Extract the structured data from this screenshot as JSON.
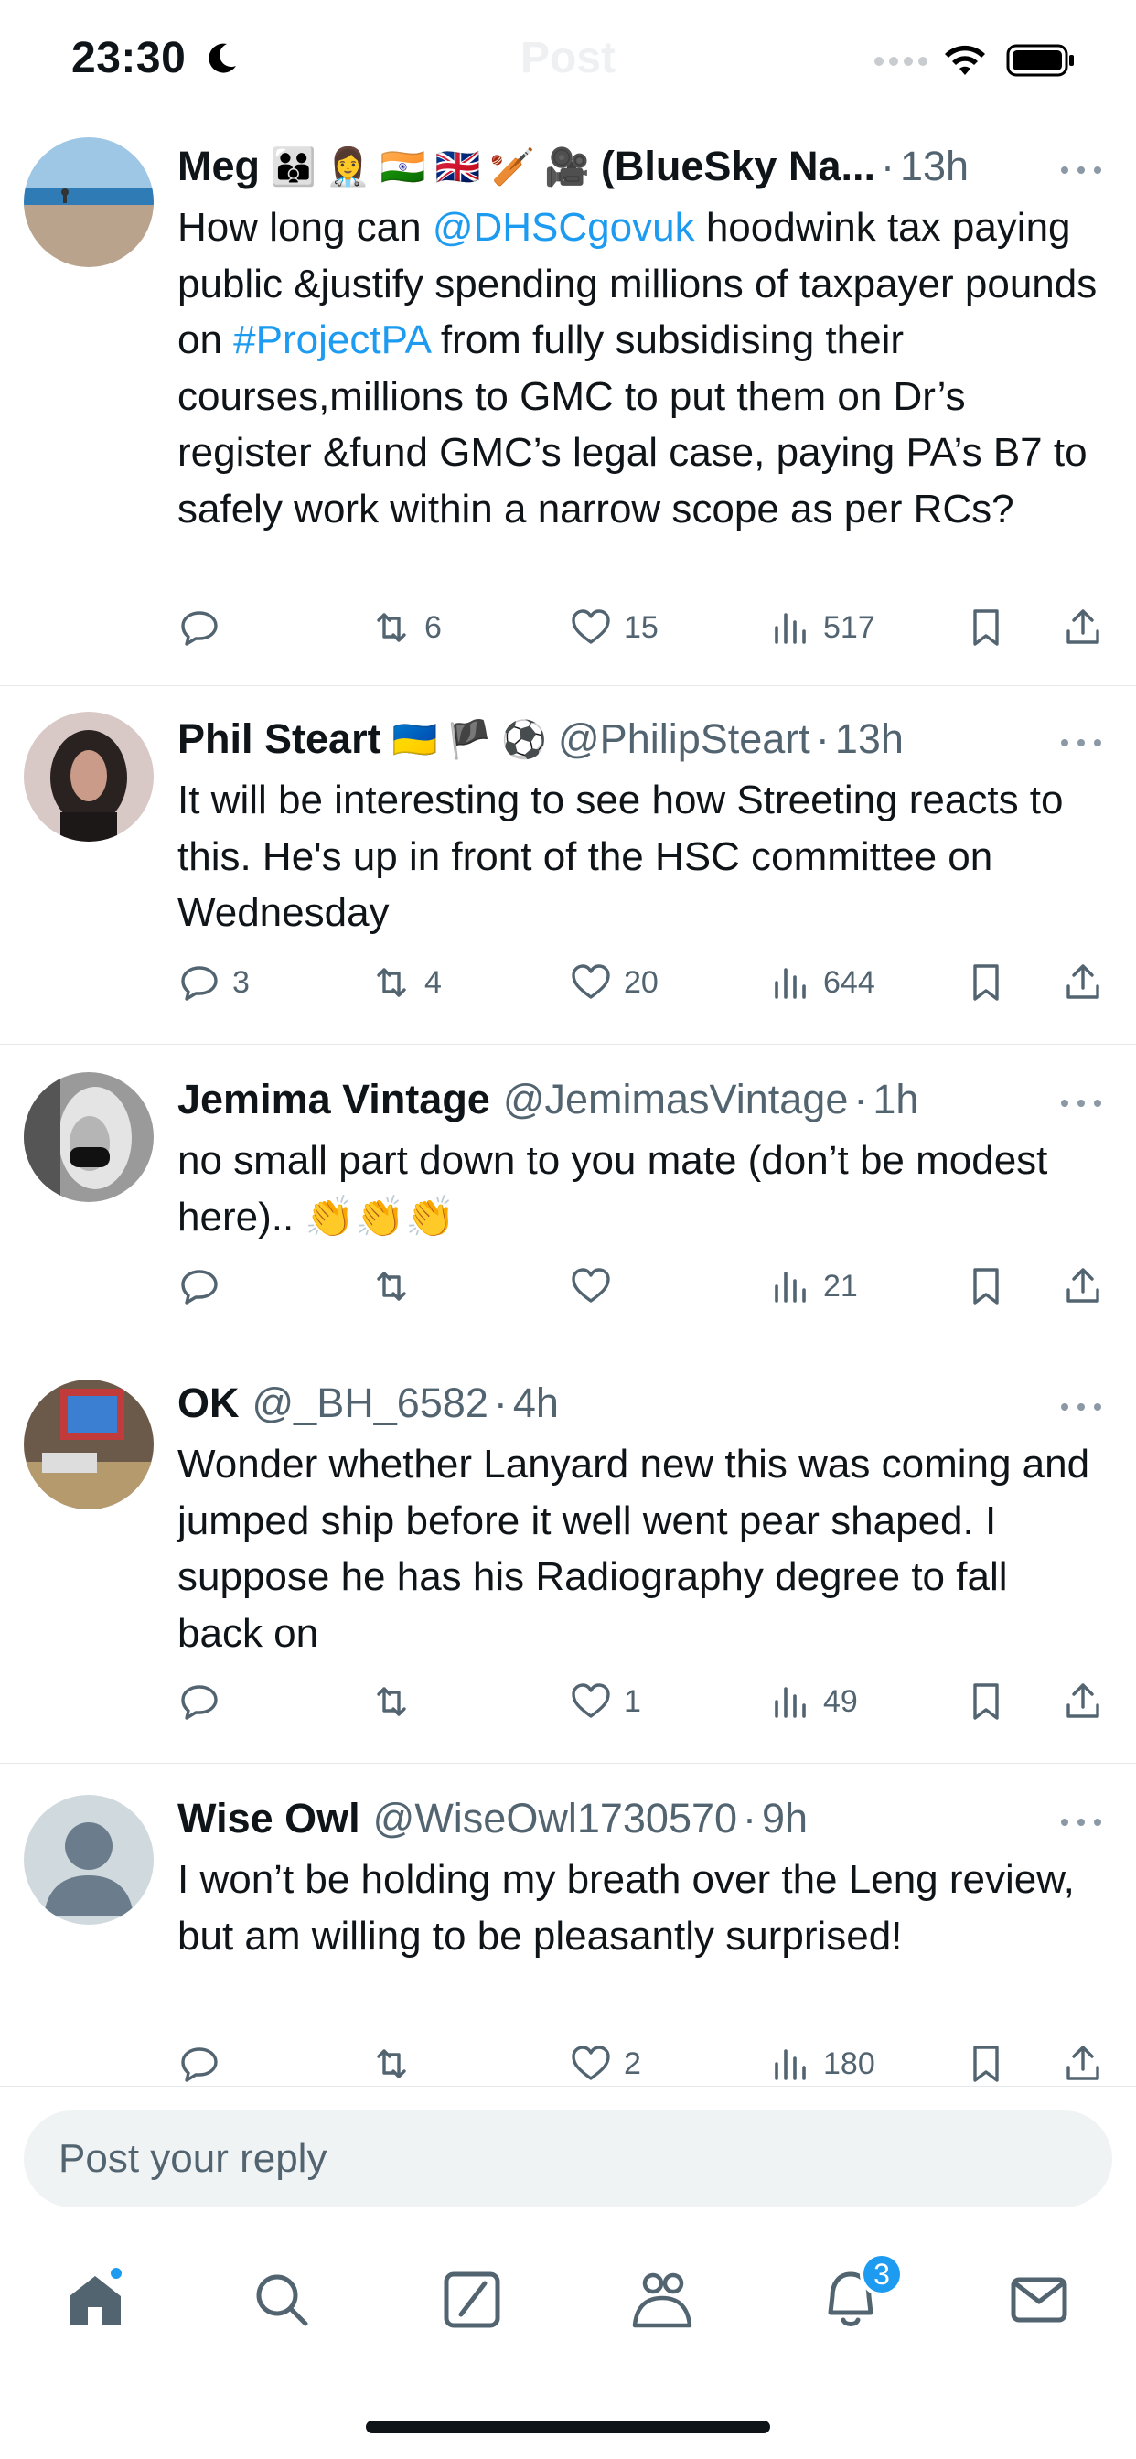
{
  "status_bar": {
    "time": "23:30",
    "ghost_title": "Post",
    "icons": [
      "moon-icon",
      "signal-icon",
      "wifi-icon",
      "battery-icon"
    ]
  },
  "colors": {
    "accent": "#1d9bf0",
    "text_primary": "#0f1419",
    "text_secondary": "#536471",
    "divider": "#e6e9ec",
    "input_bg": "#eff3f4"
  },
  "tweets": [
    {
      "name": "Meg",
      "flags": [
        "👪",
        "👩‍⚕️",
        "🇮🇳",
        "🇬🇧",
        "🏏",
        "🎥"
      ],
      "handle": "(BlueSky Na...",
      "sep": "·",
      "time": "13h",
      "body_parts": [
        {
          "text": "How long can ",
          "link": false
        },
        {
          "text": "@DHSCgovuk",
          "link": true
        },
        {
          "text": " hoodwink tax paying public &justify spending millions of taxpayer pounds on ",
          "link": false
        },
        {
          "text": "#ProjectPA",
          "link": true
        },
        {
          "text": " from fully subsidising their courses,millions to GMC to put them on Dr’s register &fund GMC’s legal case, paying PA’s B7 to safely work within a narrow scope as per RCs?",
          "link": false
        }
      ],
      "replies": "",
      "reposts": "6",
      "likes": "15",
      "views": "517"
    },
    {
      "name": "Phil Steart",
      "flags": [
        "🇺🇦",
        "🏴",
        "⚽"
      ],
      "handle": "@PhilipSteart",
      "sep": "·",
      "time": "13h",
      "body_parts": [
        {
          "text": "It will be interesting to see how Streeting reacts to this. He's up in front of the HSC committee on Wednesday",
          "link": false
        }
      ],
      "replies": "3",
      "reposts": "4",
      "likes": "20",
      "views": "644"
    },
    {
      "name": "Jemima Vintage",
      "flags": [],
      "handle": "@JemimasVintage",
      "sep": "·",
      "time": "1h",
      "body_parts": [
        {
          "text": "no small part down to you mate (don’t be modest here).. 👏👏👏",
          "link": false
        }
      ],
      "replies": "",
      "reposts": "",
      "likes": "",
      "views": "21"
    },
    {
      "name": "OK",
      "flags": [],
      "handle": "@_BH_6582",
      "sep": "·",
      "time": "4h",
      "body_parts": [
        {
          "text": "Wonder whether Lanyard new this was coming and jumped ship before it well went pear shaped. I suppose he has his Radiography degree to fall back on",
          "link": false
        }
      ],
      "replies": "",
      "reposts": "",
      "likes": "1",
      "views": "49"
    },
    {
      "name": "Wise Owl",
      "flags": [],
      "handle": "@WiseOwl1730570",
      "sep": "·",
      "time": "9h",
      "body_parts": [
        {
          "text": "I won’t be holding my breath over the Leng review, but am willing to be pleasantly surprised!",
          "link": false
        }
      ],
      "replies": "",
      "reposts": "",
      "likes": "2",
      "views": "180"
    }
  ],
  "reply": {
    "placeholder": "Post your reply"
  },
  "tabbar": {
    "items": [
      "home-icon",
      "search-icon",
      "grok-icon",
      "communities-icon",
      "notifications-icon",
      "messages-icon"
    ],
    "notifications_badge": "3"
  }
}
